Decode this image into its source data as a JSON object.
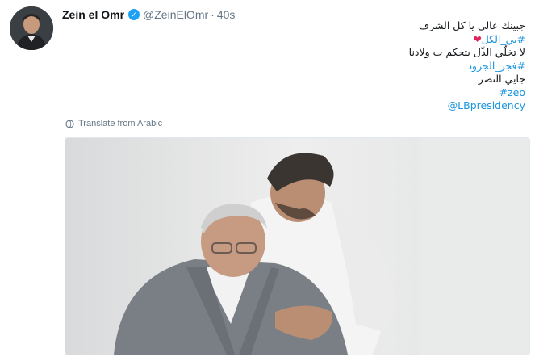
{
  "tweet": {
    "author_name": "Zein el Omr",
    "handle": "@ZeinElOmr",
    "separator": "·",
    "time": "40s",
    "lines": [
      {
        "text": "جبينك عالي يا كل الشرف",
        "kind": "text"
      },
      {
        "text": "#بي_الكل",
        "kind": "hash",
        "emoji": "❤"
      },
      {
        "text": "لا تخلّي الذّل يتحكم ب ولادنا",
        "kind": "text"
      },
      {
        "text": "#فجر_الجرود",
        "kind": "hash"
      },
      {
        "text": "جايي النصر",
        "kind": "text"
      },
      {
        "text": "#zeo",
        "kind": "ltr"
      },
      {
        "text": "@LBpresidency",
        "kind": "ltr"
      }
    ],
    "translate_label": "Translate from Arabic"
  },
  "icons": {
    "verified": "verified-badge-icon",
    "globe": "globe-icon"
  },
  "colors": {
    "link": "#1b95e0",
    "verified": "#1da1f2",
    "heart": "#e0245e",
    "muted": "#657786"
  }
}
